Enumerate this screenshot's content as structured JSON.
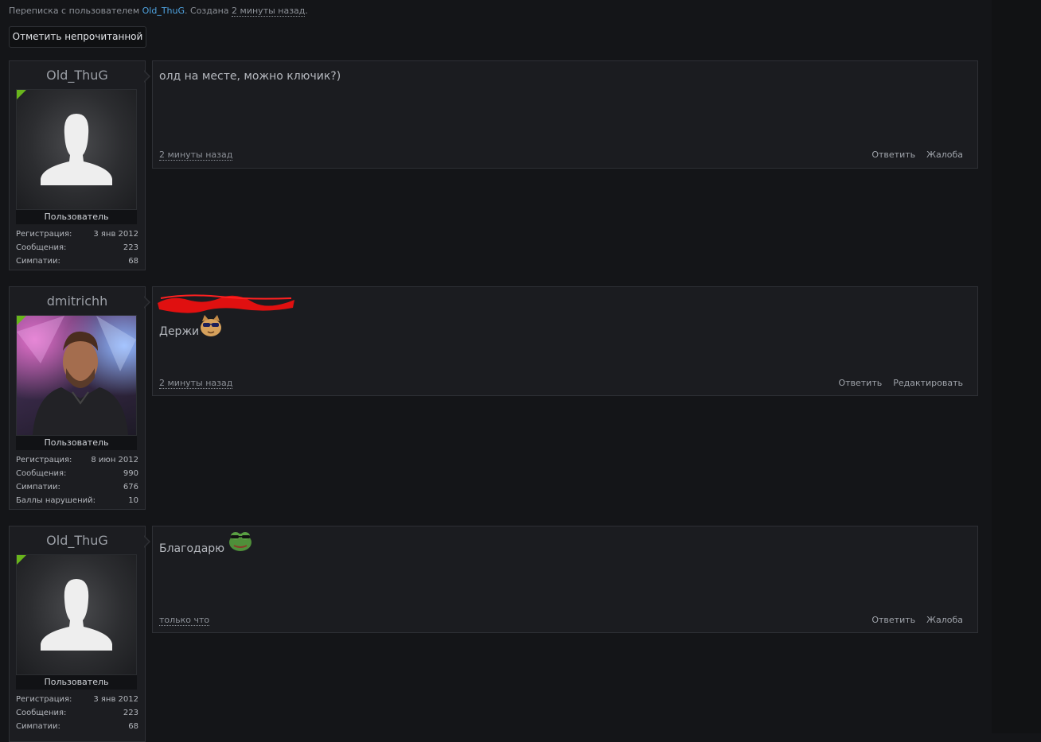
{
  "header": {
    "conversation_prefix": "Переписка с пользователем ",
    "conversation_user": "Old_ThuG",
    "created_prefix": ". Создана ",
    "created_time": "2 минуты назад",
    "created_suffix": ".",
    "mark_unread_label": "Отметить непрочитанной"
  },
  "messages": [
    {
      "user": {
        "name": "Old_ThuG",
        "role": "Пользователь",
        "stats": [
          {
            "label": "Регистрация:",
            "value": "3 янв 2012"
          },
          {
            "label": "Сообщения:",
            "value": "223"
          },
          {
            "label": "Симпатии:",
            "value": "68"
          }
        ]
      },
      "text": "олд на месте, можно ключик?)",
      "time": "2 минуты назад",
      "actions": [
        "Ответить",
        "Жалоба"
      ]
    },
    {
      "user": {
        "name": "dmitrichh",
        "role": "Пользователь",
        "stats": [
          {
            "label": "Регистрация:",
            "value": "8 июн 2012"
          },
          {
            "label": "Сообщения:",
            "value": "990"
          },
          {
            "label": "Симпатии:",
            "value": "676"
          },
          {
            "label": "Баллы нарушений:",
            "value": "10"
          }
        ]
      },
      "text": "Держи",
      "time": "2 минуты назад",
      "actions": [
        "Ответить",
        "Редактировать"
      ]
    },
    {
      "user": {
        "name": "Old_ThuG",
        "role": "Пользователь",
        "stats": [
          {
            "label": "Регистрация:",
            "value": "3 янв 2012"
          },
          {
            "label": "Сообщения:",
            "value": "223"
          },
          {
            "label": "Симпатии:",
            "value": "68"
          }
        ]
      },
      "text": "Благодарю",
      "time": "только что",
      "actions": [
        "Ответить",
        "Жалоба"
      ]
    }
  ],
  "colors": {
    "background": "#141518",
    "card": "#1c1d21",
    "online": "#69b51c",
    "link": "#4fa3e0"
  },
  "icons": [
    "default-avatar-icon",
    "cool-cat-emoji",
    "pepe-frog-emoji",
    "online-indicator-icon"
  ]
}
